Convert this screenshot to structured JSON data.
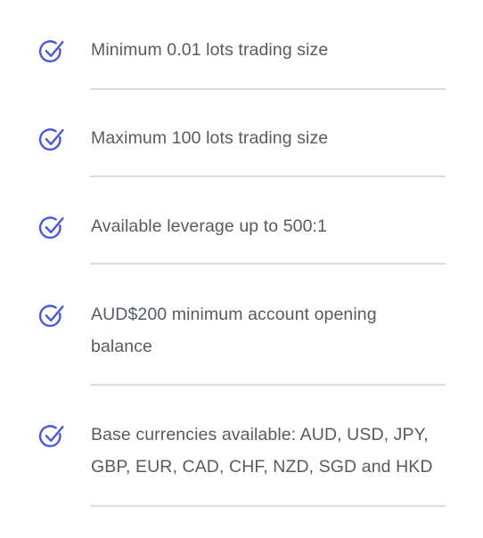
{
  "features": {
    "accent_color": "#4b57e0",
    "icon": "circle-check-icon",
    "items": [
      {
        "text": "Minimum 0.01 lots trading size"
      },
      {
        "text": "Maximum 100 lots trading size"
      },
      {
        "text": "Available leverage up to 500:1"
      },
      {
        "text": "AUD$200 minimum account opening balance"
      },
      {
        "text": "Base currencies available: AUD, USD, JPY, GBP, EUR, CAD, CHF, NZD, SGD and HKD"
      }
    ]
  }
}
